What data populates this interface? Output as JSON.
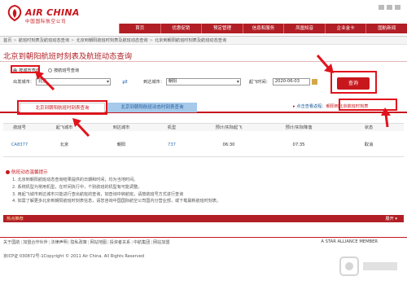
{
  "header": {
    "brand": "AIR CHINA",
    "brand_cn": "中国国际航空公司",
    "nav": [
      "首页",
      "优惠促销",
      "预定管理",
      "信息和服务",
      "凤凰知音",
      "企业金卡",
      "国航新闻"
    ]
  },
  "breadcrumb": [
    "首页",
    "航班时刻表及航班动态查询",
    "北京到朝阳航班时刻表及航班动态查询",
    "北京到朝阳航班时刻表及航班动态查询"
  ],
  "page_title": "北京到朝阳航班时刻表及航班动态查询",
  "search": {
    "radio_city": "按城市查询",
    "radio_flight": "按航班号查询",
    "from_label": "出发城市：",
    "from_value": "北京",
    "to_label": "到达城市：",
    "to_value": "朝阳",
    "date_label": "起飞时间：",
    "date_value": "2020-06-03",
    "query_button": "查询"
  },
  "tabs": {
    "tab1": "北京到朝阳航班时刻表查询",
    "tab2": "北京到朝阳航班动态时刻表查询",
    "link_text": "点击查看返程：",
    "link_red": "朝阳到北京航班时刻表"
  },
  "table": {
    "headers": [
      "航班号",
      "起飞城市",
      "到达城市",
      "机型",
      "预计/实际起飞",
      "预计/实际降落",
      "状态"
    ],
    "row": [
      "CA8377",
      "北京",
      "朝阳",
      "737",
      "06:30",
      "07:35",
      "取消"
    ]
  },
  "notes": {
    "title": "航班动态温馨提示",
    "lines": [
      "1. 北京到朝阳航班动态查询结果提供的日期和时间，均为当地时间。",
      "2. 系统机型为常用机型，在时间执行中，个别航班的机型有可能调整。",
      "3. 用起飞城市到达城市只能进行查出航班的查询，如查询中转航班，请按航班号方式进行查询",
      "4. 如需了解更多北京到朝阳航班时刻表信息，请您咨询中国国际航空公司国内分营业部，或下载最新航班时刻表。"
    ],
    "red_phrase": "国内分营业部",
    "blue_phrase": "最新航班时刻表"
  },
  "hot": {
    "left": "热点推荐",
    "right": "展开"
  },
  "footer": {
    "links": [
      "关于国航",
      "加盟合作伙伴",
      "法律声明",
      "隐私政策",
      "网站地图",
      "投资者关系",
      "中航集团",
      "网站加盟"
    ],
    "alliance": "A STAR ALLIANCE MEMBER",
    "copyright": "京ICP证 030872号-1Copyright © 2011 Air China. All Rights Reserved"
  },
  "colors": {
    "brand_red": "#c8161d",
    "nav_red": "#b21e25",
    "link_blue": "#2a6fb5"
  }
}
